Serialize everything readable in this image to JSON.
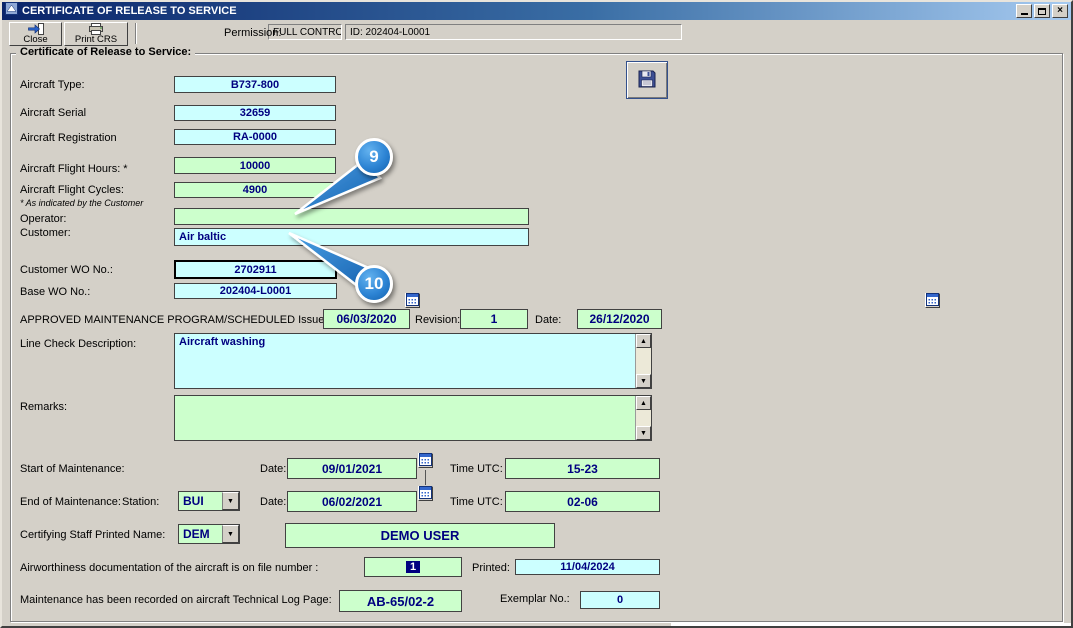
{
  "window": {
    "title": "CERTIFICATE OF RELEASE TO SERVICE"
  },
  "icons": {
    "window_close": "×",
    "dropdown_arrow": "▼",
    "scroll_up": "▲",
    "scroll_down": "▼"
  },
  "toolbar": {
    "close": "Close",
    "print": "Print CRS",
    "permission_label": "Permission:",
    "permission_value": "FULL CONTROL",
    "id_text": "ID: 202404-L0001"
  },
  "group_title": "Certificate of Release to Service:",
  "aircraft": {
    "type_label": "Aircraft Type:",
    "type": "B737-800",
    "serial_label": "Aircraft Serial",
    "serial": "32659",
    "reg_label": "Aircraft Registration",
    "reg": "RA-0000",
    "hours_label": "Aircraft Flight Hours: *",
    "hours": "10000",
    "cycles_label": "Aircraft Flight Cycles:",
    "cycles": "4900",
    "note": "* As indicated by the Customer"
  },
  "parties": {
    "operator_label": "Operator:",
    "operator": "",
    "customer_label": "Customer:",
    "customer": "Air baltic"
  },
  "workorders": {
    "customer_wo_label": "Customer WO No.:",
    "customer_wo": "2702911",
    "base_wo_label": "Base WO No.:",
    "base_wo": "202404-L0001"
  },
  "amp": {
    "label": "APPROVED MAINTENANCE PROGRAM/SCHEDULED Issue :",
    "issue": "06/03/2020",
    "revision_label": "Revision:",
    "revision": "1",
    "date_label": "Date:",
    "date": "26/12/2020"
  },
  "line_check": {
    "label": "Line Check Description:",
    "text": "Aircraft washing"
  },
  "remarks": {
    "label": "Remarks:",
    "text": ""
  },
  "start_maintenance": {
    "label": "Start of Maintenance:",
    "date_label": "Date:",
    "date": "09/01/2021",
    "time_label": "Time UTC:",
    "time": "15-23"
  },
  "end_maintenance": {
    "label": "End of Maintenance:",
    "station_label": "Station:",
    "station": "BUI",
    "date_label": "Date:",
    "date": "06/02/2021",
    "time_label": "Time UTC:",
    "time": "02-06"
  },
  "certifying": {
    "label": "Certifying Staff Printed Name:",
    "code": "DEM",
    "name": "DEMO USER"
  },
  "airworthiness": {
    "label": "Airworthiness documentation of the aircraft is on file number :",
    "file_no": "1",
    "printed_label": "Printed:",
    "printed": "11/04/2024"
  },
  "techlog": {
    "label": "Maintenance has been recorded on aircraft Technical Log Page:",
    "page": "AB-65/02-2",
    "exemplar_label": "Exemplar No.:",
    "exemplar": "0"
  },
  "callouts": {
    "step9": "9",
    "step10": "10"
  },
  "colors": {
    "field_cyan": "#ccffff",
    "field_green": "#ccffcc",
    "titlebar_blue": "#0a246a",
    "callout_blue": "#1f6fc4",
    "value_navy": "#000080"
  }
}
